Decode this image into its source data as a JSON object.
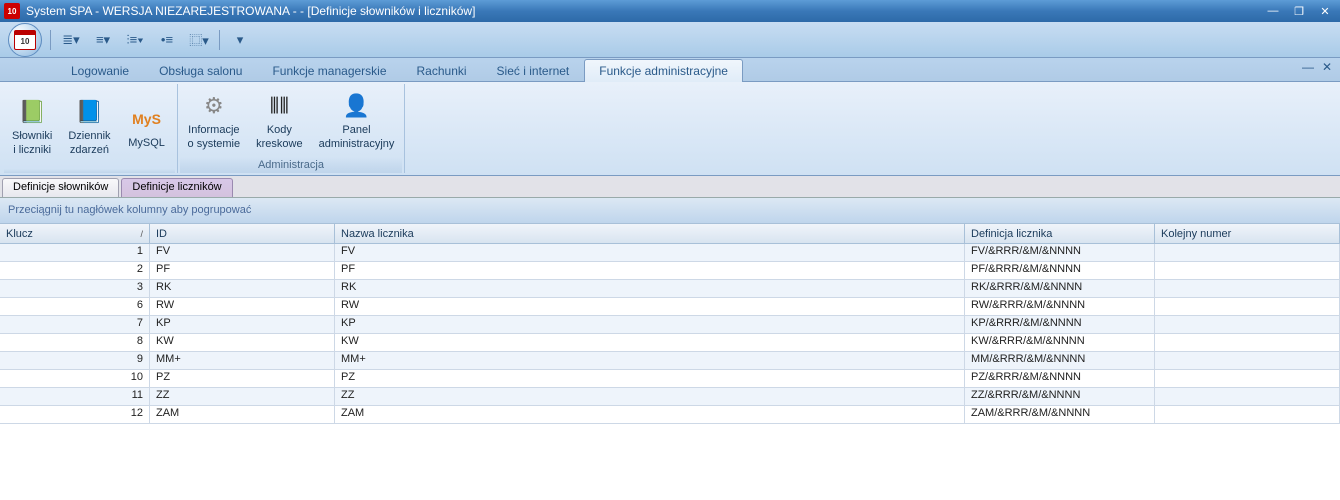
{
  "titlebar": {
    "text": "System SPA - WERSJA NIEZAREJESTROWANA -  - [Definicje słowników i liczników]",
    "icon_label": "10"
  },
  "orb": {
    "label": "10"
  },
  "menutabs": {
    "items": [
      {
        "label": "Logowanie"
      },
      {
        "label": "Obsługa salonu"
      },
      {
        "label": "Funkcje managerskie"
      },
      {
        "label": "Rachunki"
      },
      {
        "label": "Sieć i internet"
      },
      {
        "label": "Funkcje administracyjne"
      }
    ],
    "active_index": 5
  },
  "ribbon": {
    "groups": [
      {
        "label": "",
        "items": [
          {
            "label": "Słowniki\ni liczniki",
            "icon": "📗",
            "name": "ribbon-slowniki"
          },
          {
            "label": "Dziennik\nzdarzeń",
            "icon": "📘",
            "name": "ribbon-dziennik"
          },
          {
            "label": "MySQL",
            "icon": "MyS",
            "name": "ribbon-mysql"
          }
        ]
      },
      {
        "label": "Administracja",
        "items": [
          {
            "label": "Informacje\no systemie",
            "icon": "⚙",
            "name": "ribbon-informacje"
          },
          {
            "label": "Kody\nkreskowe",
            "icon": "⦀⦀",
            "name": "ribbon-kody"
          },
          {
            "label": "Panel\nadministracyjny",
            "icon": "👤",
            "name": "ribbon-panel"
          }
        ]
      }
    ]
  },
  "subtabs": {
    "items": [
      {
        "label": "Definicje słowników"
      },
      {
        "label": "Definicje liczników"
      }
    ],
    "active_index": 1
  },
  "groupby": {
    "text": "Przeciągnij tu nagłówek kolumny aby pogrupować"
  },
  "grid": {
    "columns": [
      {
        "label": "Klucz",
        "key": "klucz",
        "sortmark": "/"
      },
      {
        "label": "ID",
        "key": "id"
      },
      {
        "label": "Nazwa licznika",
        "key": "nazwa"
      },
      {
        "label": "Definicja licznika",
        "key": "def"
      },
      {
        "label": "Kolejny numer",
        "key": "kolejny"
      }
    ],
    "rows": [
      {
        "klucz": "1",
        "id": "FV",
        "nazwa": "FV",
        "def": "FV/&RRR/&M/&NNNN",
        "kolejny": ""
      },
      {
        "klucz": "2",
        "id": "PF",
        "nazwa": "PF",
        "def": "PF/&RRR/&M/&NNNN",
        "kolejny": ""
      },
      {
        "klucz": "3",
        "id": "RK",
        "nazwa": "RK",
        "def": "RK/&RRR/&M/&NNNN",
        "kolejny": ""
      },
      {
        "klucz": "6",
        "id": "RW",
        "nazwa": "RW",
        "def": "RW/&RRR/&M/&NNNN",
        "kolejny": ""
      },
      {
        "klucz": "7",
        "id": "KP",
        "nazwa": "KP",
        "def": "KP/&RRR/&M/&NNNN",
        "kolejny": ""
      },
      {
        "klucz": "8",
        "id": "KW",
        "nazwa": "KW",
        "def": "KW/&RRR/&M/&NNNN",
        "kolejny": ""
      },
      {
        "klucz": "9",
        "id": "MM+",
        "nazwa": "MM+",
        "def": "MM/&RRR/&M/&NNNN",
        "kolejny": ""
      },
      {
        "klucz": "10",
        "id": "PZ",
        "nazwa": "PZ",
        "def": "PZ/&RRR/&M/&NNNN",
        "kolejny": ""
      },
      {
        "klucz": "11",
        "id": "ZZ",
        "nazwa": "ZZ",
        "def": "ZZ/&RRR/&M/&NNNN",
        "kolejny": ""
      },
      {
        "klucz": "12",
        "id": "ZAM",
        "nazwa": "ZAM",
        "def": "ZAM/&RRR/&M/&NNNN",
        "kolejny": ""
      }
    ]
  }
}
